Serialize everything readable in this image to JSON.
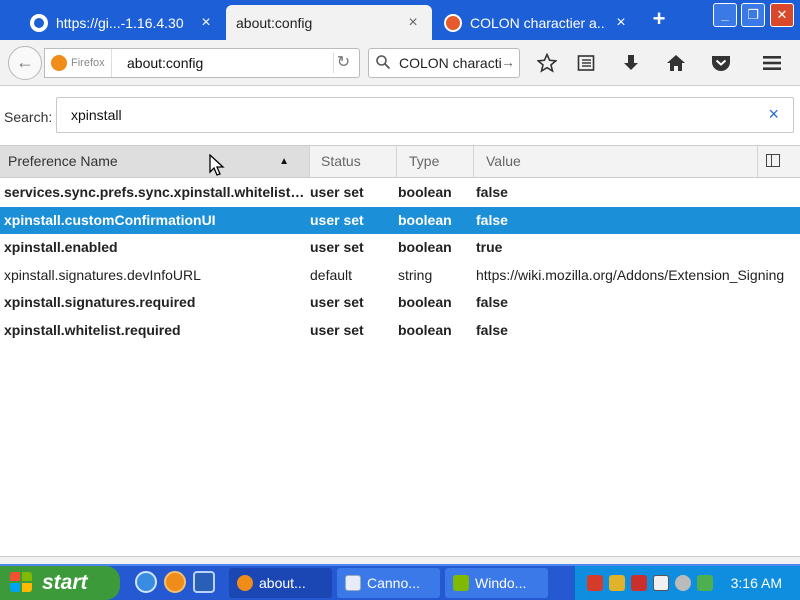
{
  "browser": {
    "tabs": [
      {
        "title": "https://gi...-1.16.4.30",
        "close": "×",
        "active": false
      },
      {
        "title": "about:config",
        "close": "×",
        "active": true
      },
      {
        "title": "COLON charactier a...",
        "close": "×",
        "active": false
      }
    ],
    "new_tab": "+",
    "window_controls": {
      "minimize": "_",
      "maximize": "❐",
      "close": "✕"
    },
    "nav": {
      "back": "←",
      "identity_label": "Firefox",
      "url": "about:config",
      "reload": "↻",
      "search_text": "COLON characti",
      "search_go": "→",
      "toolbar_icons": [
        "star-icon",
        "reading-list-icon",
        "download-icon",
        "home-icon",
        "pocket-icon",
        "menu-icon"
      ]
    }
  },
  "config": {
    "search_label": "Search:",
    "search_value": "xpinstall",
    "clear_icon": "×",
    "columns": {
      "name": "Preference Name",
      "status": "Status",
      "type": "Type",
      "value": "Value"
    },
    "sort_indicator": "▲",
    "rows": [
      {
        "name": "services.sync.prefs.sync.xpinstall.whitelist.required",
        "status": "user set",
        "type": "boolean",
        "value": "false",
        "bold": true,
        "selected": false
      },
      {
        "name": "xpinstall.customConfirmationUI",
        "status": "user set",
        "type": "boolean",
        "value": "false",
        "bold": true,
        "selected": true
      },
      {
        "name": "xpinstall.enabled",
        "status": "user set",
        "type": "boolean",
        "value": "true",
        "bold": true,
        "selected": false
      },
      {
        "name": "xpinstall.signatures.devInfoURL",
        "status": "default",
        "type": "string",
        "value": "https://wiki.mozilla.org/Addons/Extension_Signing",
        "bold": false,
        "selected": false
      },
      {
        "name": "xpinstall.signatures.required",
        "status": "user set",
        "type": "boolean",
        "value": "false",
        "bold": true,
        "selected": false
      },
      {
        "name": "xpinstall.whitelist.required",
        "status": "user set",
        "type": "boolean",
        "value": "false",
        "bold": true,
        "selected": false
      }
    ]
  },
  "taskbar": {
    "start_label": "start",
    "items": [
      {
        "label": "about...",
        "active": true
      },
      {
        "label": "Canno...",
        "active": false
      },
      {
        "label": "Windo...",
        "active": false
      }
    ],
    "clock": "3:16 AM"
  },
  "colors": {
    "tab_strip": "#1c5fd6",
    "selection": "#1c8fd9",
    "taskbar": "#2459d1",
    "start_button": "#3c9a3a",
    "tray": "#0f8ee0"
  }
}
